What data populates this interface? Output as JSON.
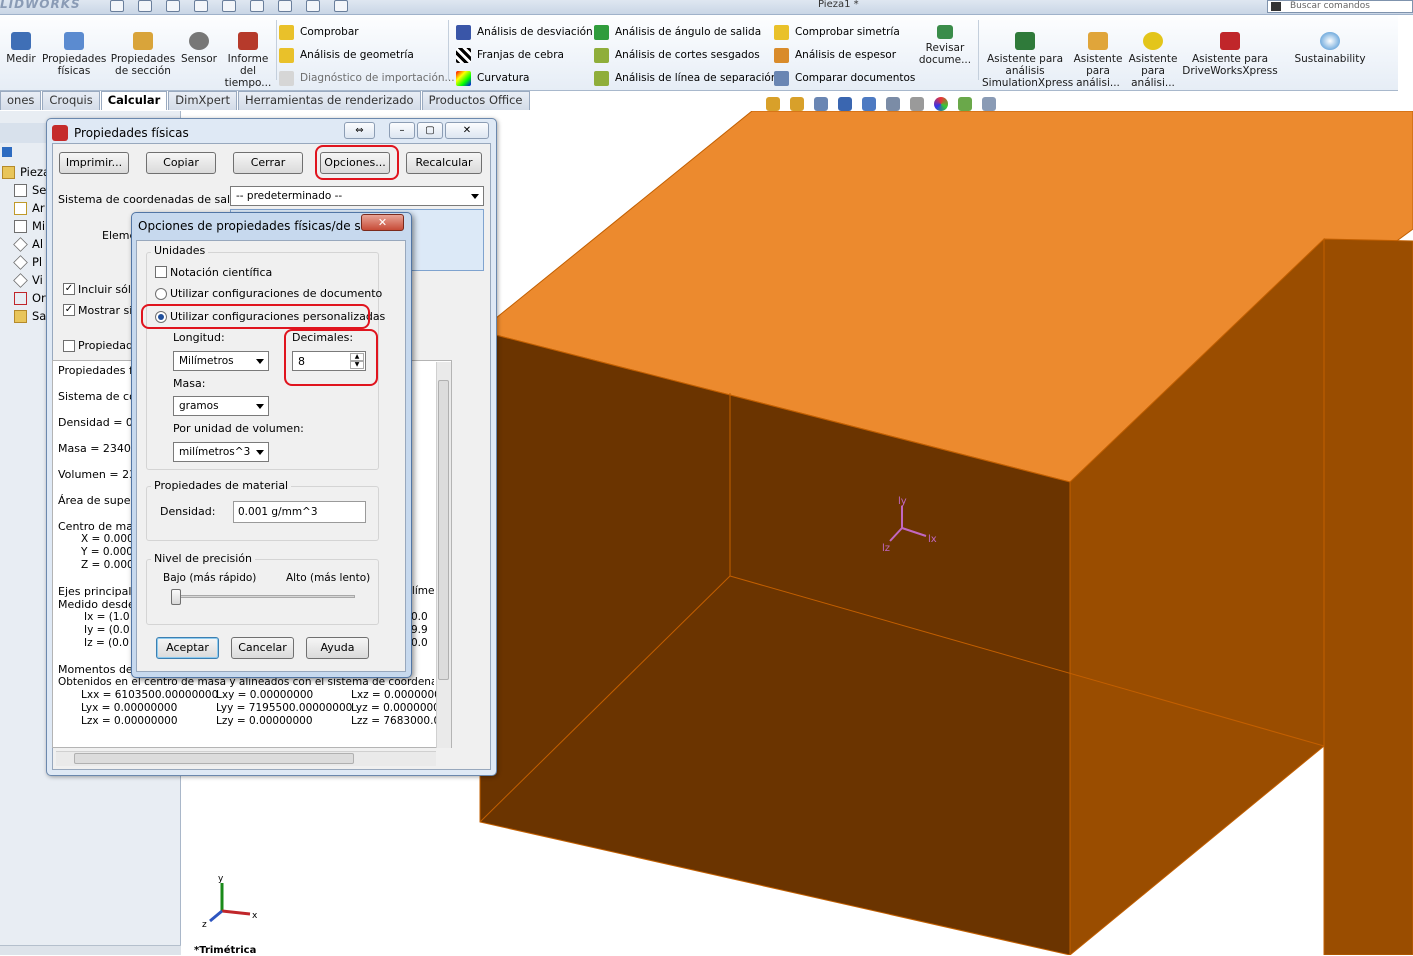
{
  "app": {
    "logo": "LIDWORKS",
    "doc_title": "Pieza1 *",
    "search_placeholder": "Buscar comandos"
  },
  "ribbon": {
    "big_buttons_left": [
      {
        "label": "Medir",
        "icon": "ruler-icon"
      },
      {
        "label": "Propiedades\nfísicas",
        "icon": "scale-icon"
      },
      {
        "label": "Propiedades\nde sección",
        "icon": "section-icon"
      },
      {
        "label": "Sensor",
        "icon": "gauge-icon"
      },
      {
        "label": "Informe\ndel\ntiempo...",
        "icon": "report-icon"
      }
    ],
    "col1": [
      "Comprobar",
      "Análisis de geometría",
      "Diagnóstico de importación..."
    ],
    "col2": [
      "Análisis de desviación",
      "Franjas de cebra",
      "Curvatura"
    ],
    "col3": [
      "Análisis de ángulo de salida",
      "Análisis de cortes sesgados",
      "Análisis de línea de separación"
    ],
    "col4": [
      "Comprobar simetría",
      "Análisis de espesor",
      "Comparar documentos"
    ],
    "revisar": "Revisar\ndocume...",
    "big_buttons_right": [
      {
        "label": "Asistente para\nanálisis\nSimulationXpress",
        "icon": "simulation-icon"
      },
      {
        "label": "Asistente\npara\nanálisi...",
        "icon": "flow-icon"
      },
      {
        "label": "Asistente\npara\nanálisi...",
        "icon": "check-icon"
      },
      {
        "label": "Asistente para\nDriveWorksXpress",
        "icon": "driveworks-icon"
      },
      {
        "label": "Sustainability",
        "icon": "sustainability-icon"
      }
    ]
  },
  "tabs": [
    "ones",
    "Croquis",
    "Calcular",
    "DimXpert",
    "Herramientas de renderizado",
    "Productos Office"
  ],
  "active_tab": "Calcular",
  "tree": {
    "items": [
      "Pieza1",
      "Se",
      "Ar",
      "Mi",
      "Al",
      "Pl",
      "Vi",
      "Or",
      "Sa"
    ]
  },
  "pp": {
    "title": "Propiedades físicas",
    "buttons": {
      "print": "Imprimir...",
      "copy": "Copiar",
      "close": "Cerrar",
      "options": "Opciones...",
      "recalc": "Recalcular"
    },
    "coord_label": "Sistema de coordenadas de salida:",
    "coord_value": "-- predeterminado --",
    "elements_label": "Eleme",
    "incluir": "Incluir sólid",
    "mostrar": "Mostrar sis",
    "propiedades": "Propiedade",
    "report": {
      "l1": "Propiedades fís",
      "l2": "Sistema de coo",
      "l3": "Densidad = 0.0",
      "l4": "Masa = 2340.0",
      "l5": "Volumen = 234",
      "l6": "Área de superf",
      "l7": "Centro de mas",
      "cx": "X = 0.000",
      "cy": "Y = 0.000",
      "cz": "Z = 0.000",
      "axes1": "Ejes principales",
      "axes2": "Medido desde e",
      "ix": "Ix = (1.0",
      "iy": "Iy = (0.0",
      "iz": "Iz = (0.0",
      "r_ix": "0.0",
      "r_iy": "9.9",
      "r_iz": "0.0",
      "r_unit": "ilíme",
      "mom1": "Momentos de in",
      "mom2": "Obtenidos en el centro de masa y alineados con el sistema de coordenadas de",
      "lxx": "Lxx = 6103500.00000000",
      "lxy": "Lxy = 0.00000000",
      "lxz": "Lxz = 0.0000000",
      "lyx": "Lyx = 0.00000000",
      "lyy": "Lyy = 7195500.00000000",
      "lyz": "Lyz = 0.0000000",
      "lzx": "Lzx = 0.00000000",
      "lzy": "Lzy = 0.00000000",
      "lzz": "Lzz = 7683000.0"
    }
  },
  "opt": {
    "title": "Opciones de propiedades físicas/de sec...",
    "units_group": "Unidades",
    "sci": "Notación científica",
    "doc_settings": "Utilizar configuraciones de documento",
    "custom_settings": "Utilizar configuraciones personalizadas",
    "length_label": "Longitud:",
    "length_value": "Milímetros",
    "decimals_label": "Decimales:",
    "decimals_value": "8",
    "mass_label": "Masa:",
    "mass_value": "gramos",
    "per_volume_label": "Por unidad de volumen:",
    "per_volume_value": "milímetros^3",
    "material_group": "Propiedades de material",
    "density_label": "Densidad:",
    "density_value": "0.001 g/mm^3",
    "precision_group": "Nivel de precisión",
    "low": "Bajo (más rápido)",
    "high": "Alto (más lento)",
    "accept": "Aceptar",
    "cancel": "Cancelar",
    "help": "Ayuda"
  },
  "viewport": {
    "view_label": "*Trimétrica",
    "triad": {
      "x": "x",
      "y": "y",
      "z": "z"
    },
    "origin": {
      "x": "lx",
      "y": "ly",
      "z": "lz"
    }
  },
  "colors": {
    "box_top": "#ec8a2e",
    "box_front": "#6b3400",
    "box_right": "#9a4d00",
    "box_edge": "#c25f00",
    "highlight": "#e0141e"
  }
}
